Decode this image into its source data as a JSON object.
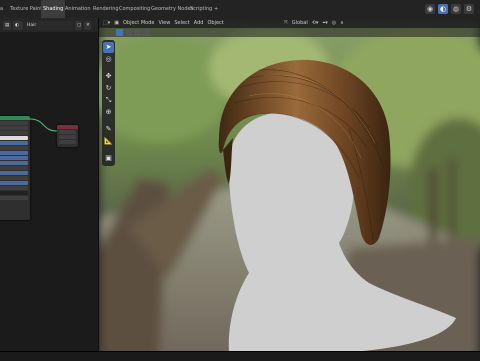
{
  "workspace_tabs": [
    {
      "label": "a",
      "active": false
    },
    {
      "label": "Texture Paint",
      "active": false
    },
    {
      "label": "Shading",
      "active": true
    },
    {
      "label": "Animation",
      "active": false
    },
    {
      "label": "Rendering",
      "active": false
    },
    {
      "label": "Compositing",
      "active": false
    },
    {
      "label": "Geometry Nodes",
      "active": false
    },
    {
      "label": "Scripting",
      "active": false
    },
    {
      "label": "+",
      "active": false
    }
  ],
  "node_editor": {
    "material_name": "Hair"
  },
  "viewport": {
    "mode_label": "Object Mode",
    "menus": [
      "View",
      "Select",
      "Add",
      "Object"
    ],
    "transform_orientation": "Global"
  },
  "icons": {
    "tools": [
      "select-cursor",
      "cursor",
      "move",
      "rotate",
      "scale",
      "transform",
      "annotate",
      "measure",
      "add-cube"
    ],
    "right_header": [
      "eye",
      "shading-solid",
      "shading-material",
      "gear"
    ]
  },
  "colors": {
    "accent_blue": "#4772b3",
    "node_green": "#2f8a55",
    "node_red": "#7a2f3a",
    "mannequin": "#cfcfcf",
    "hair_dark": "#3f2812",
    "hair_light": "#9a6a3a"
  }
}
